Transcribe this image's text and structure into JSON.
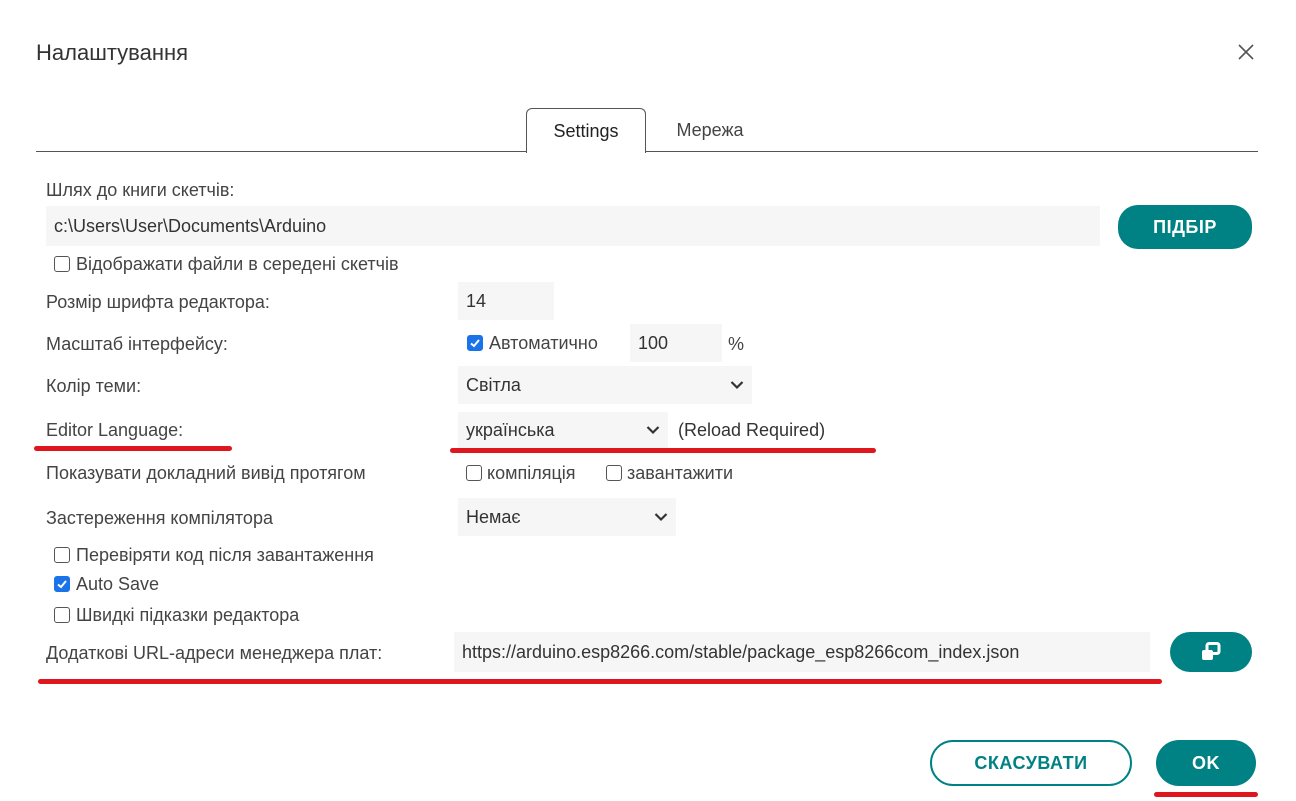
{
  "dialog": {
    "title": "Налаштування"
  },
  "tabs": [
    {
      "label": "Settings",
      "active": true
    },
    {
      "label": "Мережа",
      "active": false
    }
  ],
  "sketchbook": {
    "label": "Шлях до книги скетчів:",
    "value": "c:\\Users\\User\\Documents\\Arduino",
    "browse_label": "ПІДБІР"
  },
  "show_files": {
    "label": "Відображати файли в середені скетчів",
    "checked": false
  },
  "font_size": {
    "label": "Розмір шрифта редактора:",
    "value": "14"
  },
  "scale": {
    "label": "Масштаб інтерфейсу:",
    "auto_label": "Автоматично",
    "auto_checked": true,
    "value": "100",
    "unit": "%"
  },
  "theme": {
    "label": "Колір теми:",
    "value": "Світла"
  },
  "language": {
    "label": "Editor Language:",
    "value": "українська",
    "note": "(Reload Required)"
  },
  "verbose": {
    "label": "Показувати докладний вивід протягом",
    "compile_label": "компіляція",
    "upload_label": "завантажити"
  },
  "warnings": {
    "label": "Застереження компілятора",
    "value": "Немає"
  },
  "verify": {
    "label": "Перевіряти код після завантаження",
    "checked": false
  },
  "autosave": {
    "label": "Auto Save",
    "checked": true
  },
  "quick_hints": {
    "label": "Швидкі підказки редактора",
    "checked": false
  },
  "board_urls": {
    "label": "Додаткові URL-адреси менеджера плат:",
    "value": "https://arduino.esp8266.com/stable/package_esp8266com_index.json"
  },
  "footer": {
    "cancel_label": "СКАСУВАТИ",
    "ok_label": "OK"
  },
  "colors": {
    "accent": "#008184",
    "checkbox": "#1a73e8",
    "annotation": "#e0161e"
  }
}
